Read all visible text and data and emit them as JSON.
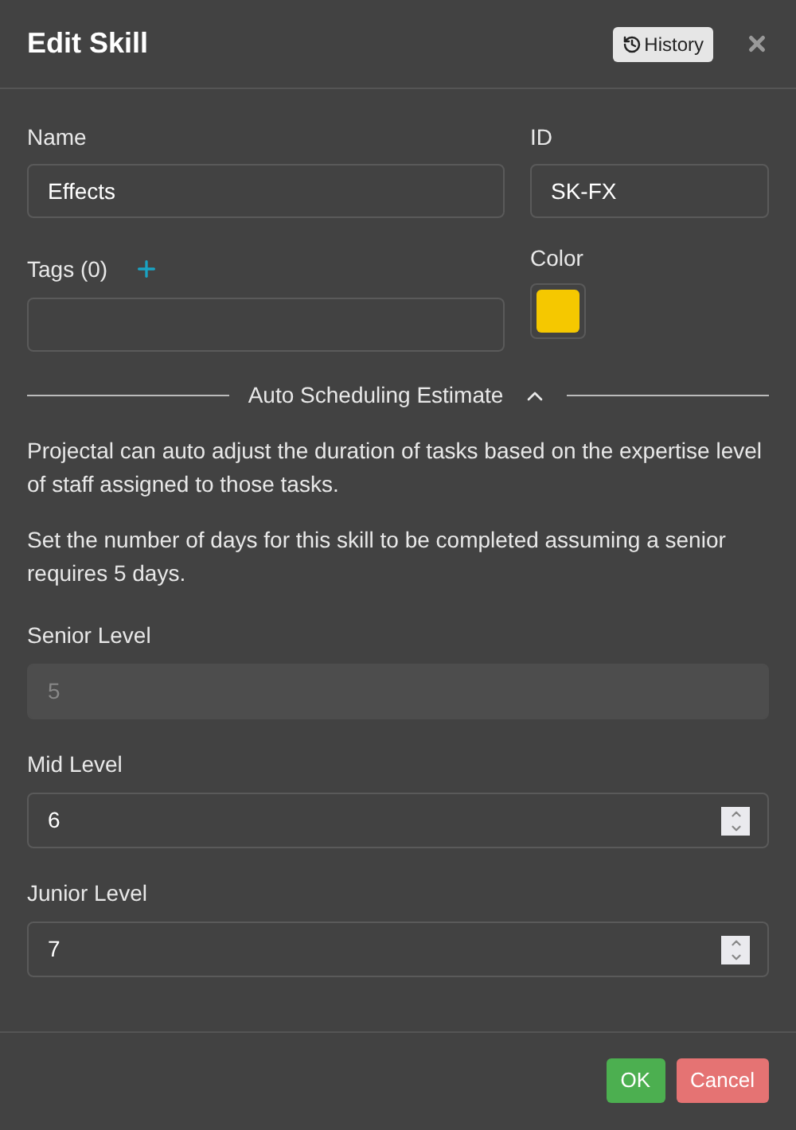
{
  "dialog": {
    "title": "Edit Skill",
    "history_button": "History"
  },
  "fields": {
    "name": {
      "label": "Name",
      "value": "Effects"
    },
    "id": {
      "label": "ID",
      "value": "SK-FX"
    },
    "tags": {
      "label": "Tags (0)"
    },
    "color": {
      "label": "Color",
      "color": "#f5c800"
    }
  },
  "section": {
    "title": "Auto Scheduling Estimate",
    "expanded": true
  },
  "paragraphs": [
    "Projectal can auto adjust the duration of tasks based on the expertise level of staff assigned to those tasks.",
    "Set the number of days for this skill to be completed assuming a senior requires 5 days."
  ],
  "levels": [
    {
      "label": "Senior Level",
      "value": "5",
      "disabled": true
    },
    {
      "label": "Mid Level",
      "value": "6",
      "disabled": false
    },
    {
      "label": "Junior Level",
      "value": "7",
      "disabled": false
    }
  ],
  "buttons": {
    "ok": "OK",
    "cancel": "Cancel"
  }
}
